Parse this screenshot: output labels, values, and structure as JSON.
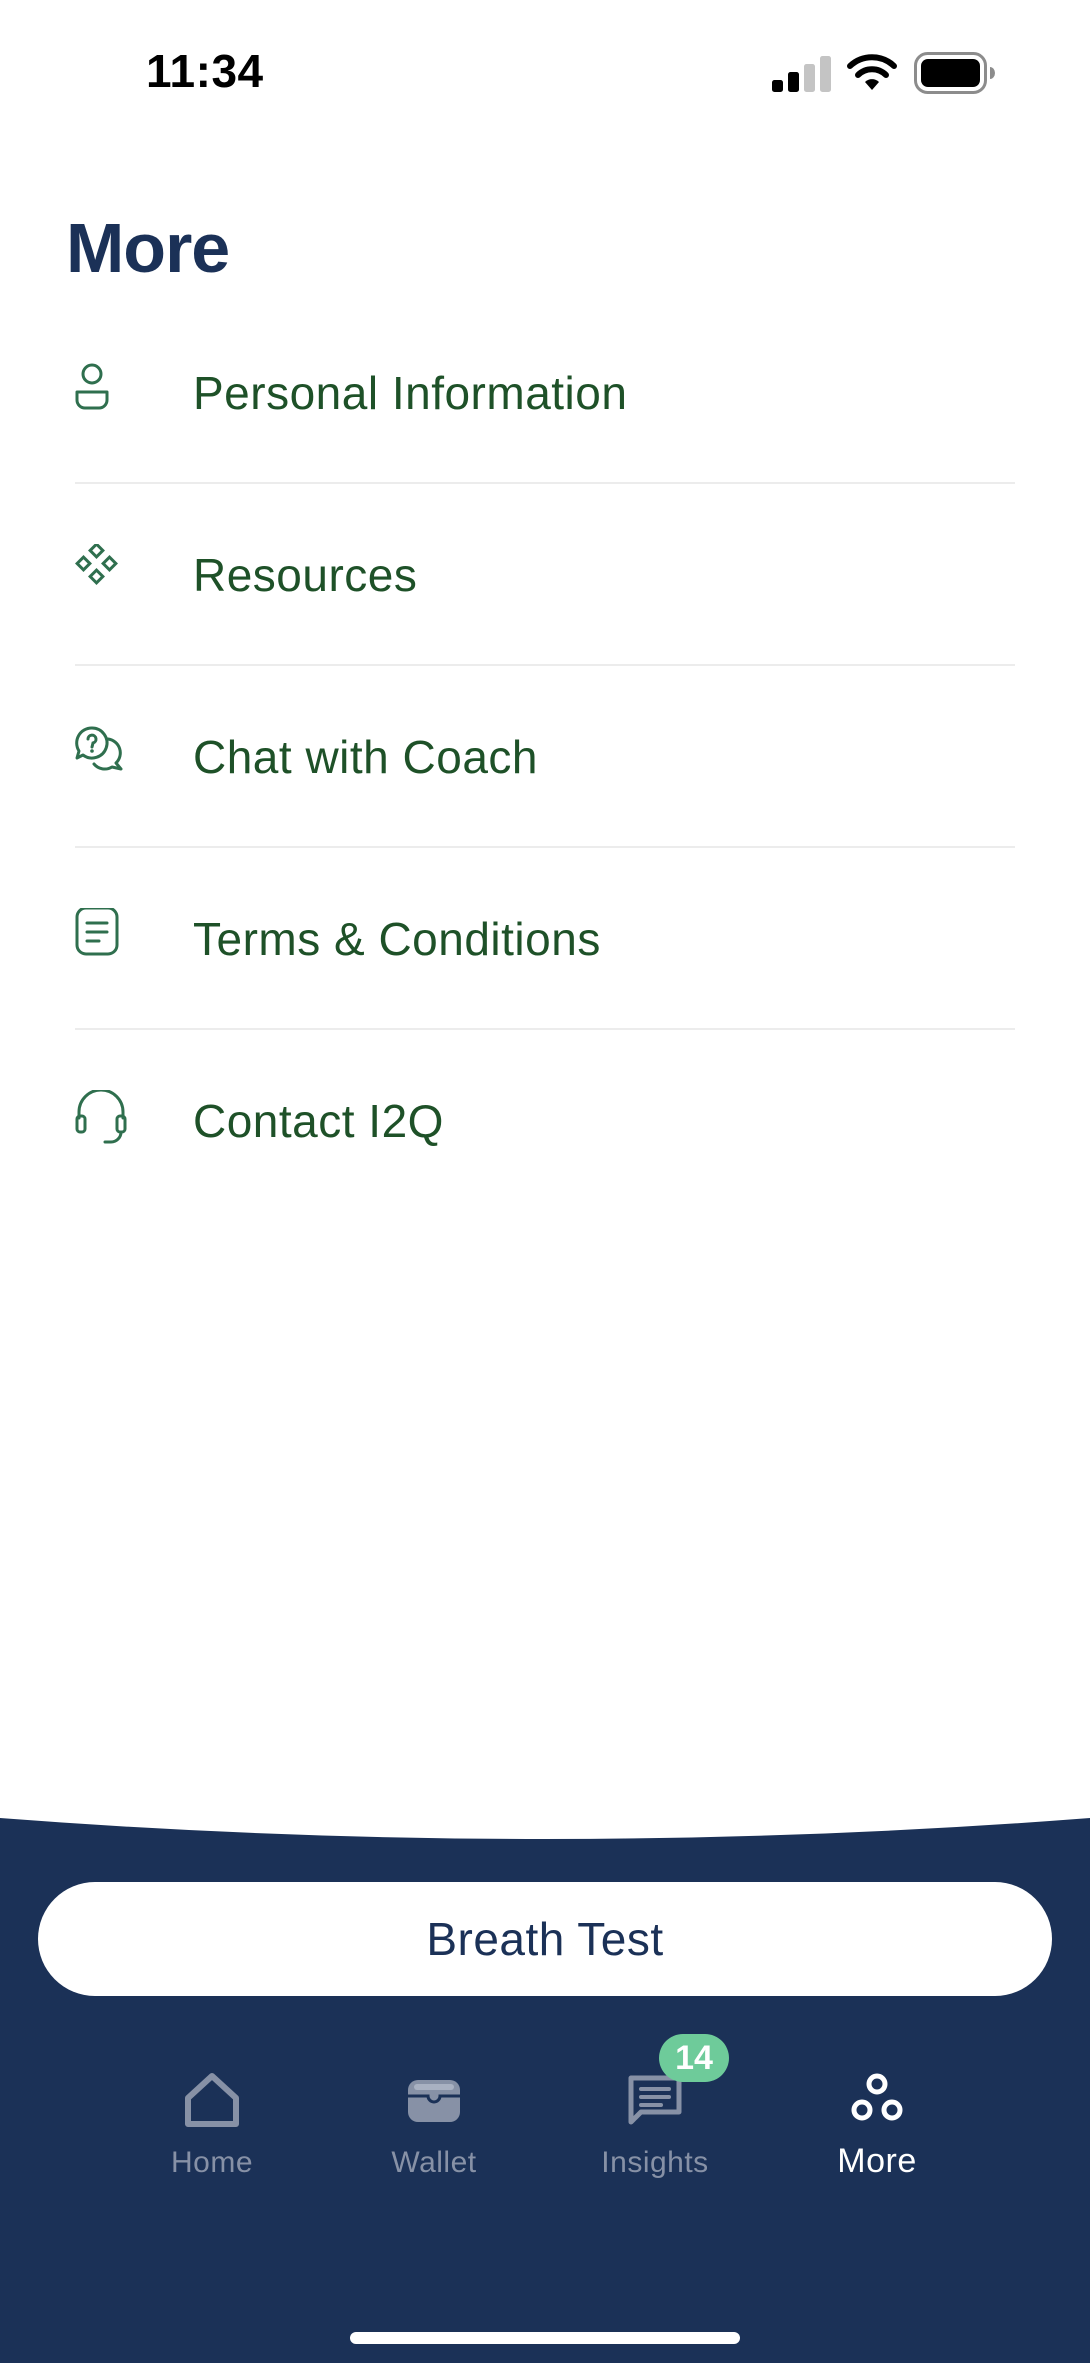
{
  "status_bar": {
    "time": "11:34",
    "icons": [
      "signal-icon",
      "wifi-icon",
      "battery-icon"
    ]
  },
  "page": {
    "title": "More"
  },
  "menu": {
    "items": [
      {
        "label": "Personal Information",
        "icon": "person-icon"
      },
      {
        "label": "Resources",
        "icon": "resources-icon"
      },
      {
        "label": "Chat with Coach",
        "icon": "chat-question-icon"
      },
      {
        "label": "Terms & Conditions",
        "icon": "document-icon"
      },
      {
        "label": "Contact I2Q",
        "icon": "headset-icon"
      }
    ]
  },
  "cta": {
    "label": "Breath Test"
  },
  "tab_bar": {
    "tabs": [
      {
        "label": "Home",
        "icon": "home-icon",
        "active": false
      },
      {
        "label": "Wallet",
        "icon": "wallet-icon",
        "active": false
      },
      {
        "label": "Insights",
        "icon": "insights-icon",
        "active": false,
        "badge": "14"
      },
      {
        "label": "More",
        "icon": "more-icon",
        "active": true
      }
    ]
  },
  "colors": {
    "title": "#1b3157",
    "menu_text": "#1e5128",
    "menu_icon": "#2f6f4e",
    "panel_bg": "#1b3157",
    "badge_bg": "#6ecb9a",
    "tab_inactive": "#8791a6",
    "tab_active": "#ffffff"
  }
}
